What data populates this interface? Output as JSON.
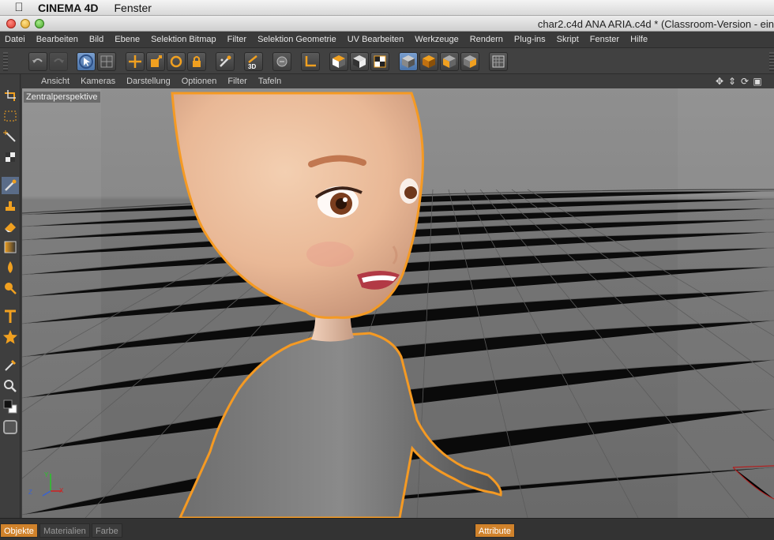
{
  "mac_menubar": {
    "app_name": "CINEMA 4D",
    "menu": "Fenster"
  },
  "window": {
    "title": "char2.c4d ANA ARIA.c4d * (Classroom-Version - ein"
  },
  "app_menu": [
    "Datei",
    "Bearbeiten",
    "Bild",
    "Ebene",
    "Selektion Bitmap",
    "Filter",
    "Selektion Geometrie",
    "UV Bearbeiten",
    "Werkzeuge",
    "Rendern",
    "Plug-ins",
    "Skript",
    "Fenster",
    "Hilfe"
  ],
  "toolbar": {
    "icons": [
      "undo-icon",
      "redo-icon",
      "selection-icon",
      "view-grid-icon",
      "move-icon",
      "scale-icon",
      "rotate-icon",
      "lock-icon",
      "paint-icon",
      "3d-paint-icon",
      "bodypaint-icon",
      "axis-icon",
      "texture-icon-1",
      "texture-icon-2",
      "texture-icon-3",
      "cube-active-icon",
      "cube-icon-2",
      "cube-icon-3",
      "cube-icon-4",
      "render-icon"
    ],
    "label_3d": "3D"
  },
  "viewport_menu": [
    "Ansicht",
    "Kameras",
    "Darstellung",
    "Optionen",
    "Filter",
    "Tafeln"
  ],
  "viewport": {
    "label": "Zentralperspektive",
    "axes": {
      "x": "X",
      "y": "Y",
      "z": "Z"
    }
  },
  "left_tools": [
    "transform-icon",
    "rect-select-icon",
    "magic-wand-icon",
    "checker-icon",
    "brush-icon",
    "stamp-icon",
    "eraser-icon",
    "gradient-icon",
    "smudge-icon",
    "dodge-icon",
    "text-icon",
    "star-icon",
    "eyedropper-icon",
    "zoom-icon",
    "color-swatch-icon",
    "layer-icon"
  ],
  "bottom_tabs": {
    "objects": "Objekte",
    "materials": "Materialien",
    "color": "Farbe",
    "attributes": "Attribute"
  },
  "colors": {
    "accent": "#d0822b",
    "selection_outline": "#f59a23",
    "active_tool": "#4b74aa"
  }
}
